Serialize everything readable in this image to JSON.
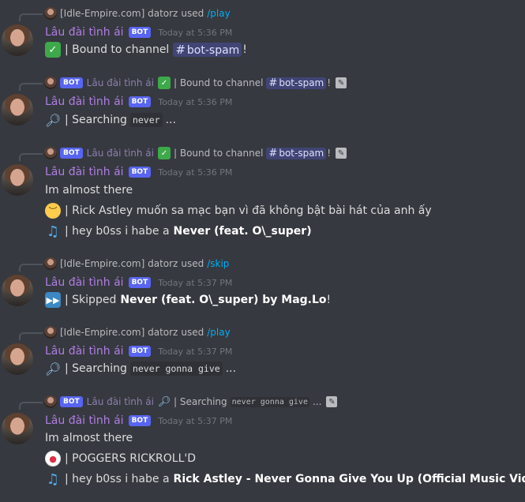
{
  "bot": {
    "name": "Lâu đài tình ái",
    "tag": "BOT"
  },
  "messages": [
    {
      "reply": {
        "user": "[Idle-Empire.com] datorz",
        "used": "used",
        "command": "/play"
      },
      "time": "Today at 5:36 PM",
      "lines": [
        {
          "emoji": "check",
          "text_a": "| Bound to channel",
          "channel": "bot-spam",
          "text_b": "!"
        }
      ]
    },
    {
      "reply": {
        "bot_name": "Lâu đài tình ái",
        "text": "| Bound to channel",
        "channel": "bot-spam",
        "text_b": "!"
      },
      "time": "Today at 5:36 PM",
      "lines": [
        {
          "emoji": "magnifier",
          "text_a": "| Searching",
          "code": "never",
          "text_b": "..."
        }
      ]
    },
    {
      "reply": {
        "bot_name": "Lâu đài tình ái",
        "text": "| Bound to channel",
        "channel": "bot-spam",
        "text_b": "!"
      },
      "time": "Today at 5:36 PM",
      "lines": [
        {
          "text": "Im almost there"
        },
        {
          "emoji": "pensive-face",
          "text": "| Rick Astley muốn sa mạc bạn vì đã không bật bài hát của anh ấy"
        },
        {
          "emoji": "musical-notes",
          "text_a": "| hey b0ss i habe a",
          "bold": "Never (feat. O\\_super)"
        }
      ]
    },
    {
      "reply": {
        "user": "[Idle-Empire.com] datorz",
        "used": "used",
        "command": "/skip"
      },
      "time": "Today at 5:37 PM",
      "lines": [
        {
          "emoji": "fast-forward",
          "text_a": "| Skipped",
          "bold": "Never (feat. O\\_super) by Mag.Lo",
          "text_b": "!"
        }
      ]
    },
    {
      "reply": {
        "user": "[Idle-Empire.com] datorz",
        "used": "used",
        "command": "/play"
      },
      "time": "Today at 5:37 PM",
      "lines": [
        {
          "emoji": "magnifier",
          "text_a": "| Searching",
          "code": "never gonna give",
          "text_b": "..."
        }
      ]
    },
    {
      "reply": {
        "bot_name": "Lâu đài tình ái",
        "text": "| Searching",
        "code": "never gonna give",
        "text_b": "..."
      },
      "time": "Today at 5:37 PM",
      "lines": [
        {
          "text": "Im almost there"
        },
        {
          "emoji": "clown-face",
          "text": "| POGGERS RICKROLL'D"
        },
        {
          "emoji": "musical-notes",
          "text_a": "| hey b0ss i habe a",
          "bold": "Rick Astley - Never Gonna Give You Up (Official Music Video)"
        }
      ]
    }
  ],
  "colors": {
    "background": "#36393f",
    "username": "#b07de4",
    "bot_tag": "#5865f2",
    "command": "#00aff4",
    "timestamp": "#72767d"
  },
  "icons": [
    "check-icon",
    "magnifier-icon",
    "pensive-face-icon",
    "musical-notes-icon",
    "fast-forward-icon",
    "clown-face-icon",
    "edited-icon"
  ]
}
